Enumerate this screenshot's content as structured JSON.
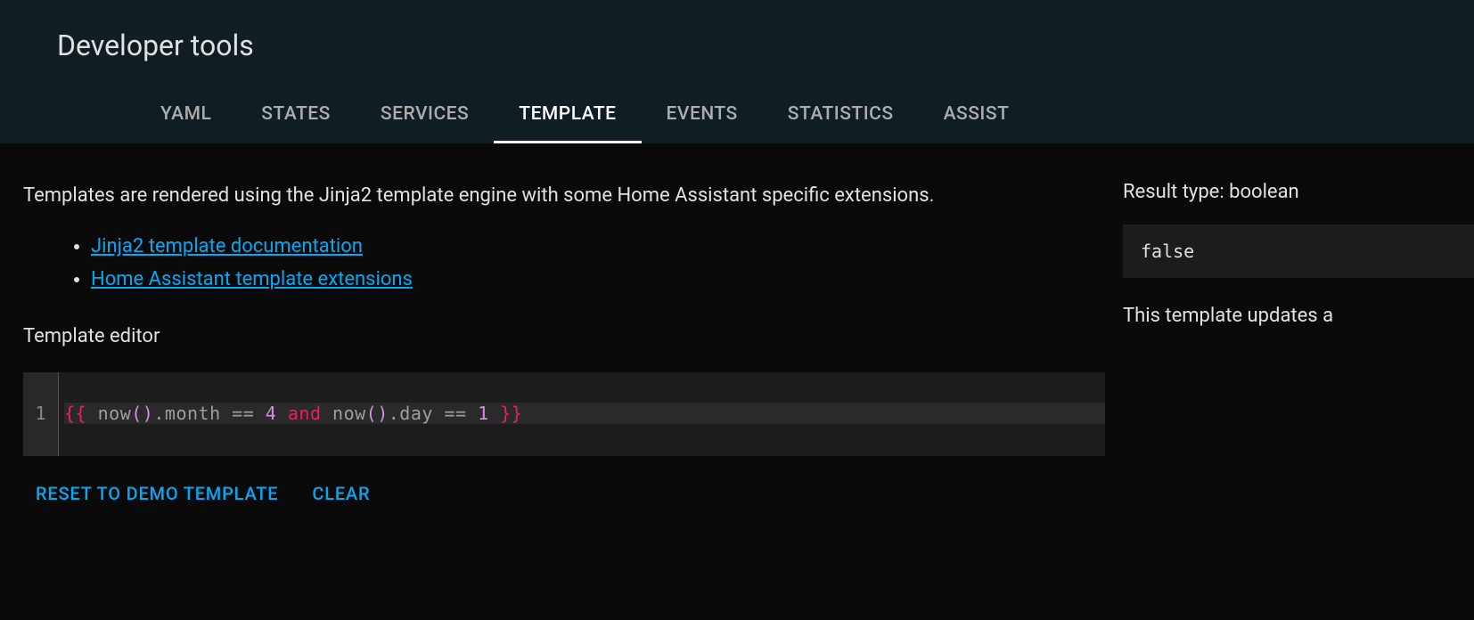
{
  "header": {
    "title": "Developer tools"
  },
  "tabs": [
    {
      "label": "YAML",
      "active": false
    },
    {
      "label": "STATES",
      "active": false
    },
    {
      "label": "SERVICES",
      "active": false
    },
    {
      "label": "TEMPLATE",
      "active": true
    },
    {
      "label": "EVENTS",
      "active": false
    },
    {
      "label": "STATISTICS",
      "active": false
    },
    {
      "label": "ASSIST",
      "active": false
    }
  ],
  "main": {
    "description": "Templates are rendered using the Jinja2 template engine with some Home Assistant specific extensions.",
    "links": [
      {
        "label": "Jinja2 template documentation"
      },
      {
        "label": "Home Assistant template extensions"
      }
    ],
    "editor_label": "Template editor",
    "editor": {
      "line_number": "1",
      "code_tokens": [
        {
          "t": "{{",
          "c": "tok-delim"
        },
        {
          "t": " now",
          "c": "tok-func"
        },
        {
          "t": "()",
          "c": "tok-paren"
        },
        {
          "t": ".month ",
          "c": "tok-prop"
        },
        {
          "t": "==",
          "c": "tok-op"
        },
        {
          "t": " 4 ",
          "c": "tok-num"
        },
        {
          "t": "and",
          "c": "tok-kw"
        },
        {
          "t": " now",
          "c": "tok-func"
        },
        {
          "t": "()",
          "c": "tok-paren"
        },
        {
          "t": ".day ",
          "c": "tok-prop"
        },
        {
          "t": "==",
          "c": "tok-op"
        },
        {
          "t": " 1 ",
          "c": "tok-num"
        },
        {
          "t": "}}",
          "c": "tok-delim"
        }
      ]
    },
    "buttons": {
      "reset": "RESET TO DEMO TEMPLATE",
      "clear": "CLEAR"
    }
  },
  "result": {
    "label": "Result type: boolean",
    "value": "false",
    "update_text": "This template updates a"
  }
}
